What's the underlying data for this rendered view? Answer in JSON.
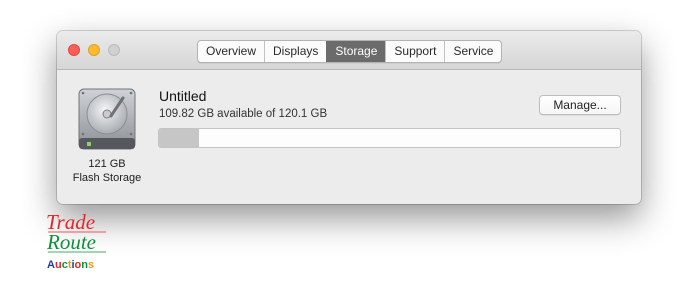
{
  "window": {
    "tabs": [
      {
        "label": "Overview",
        "active": false
      },
      {
        "label": "Displays",
        "active": false
      },
      {
        "label": "Storage",
        "active": true
      },
      {
        "label": "Support",
        "active": false
      },
      {
        "label": "Service",
        "active": false
      }
    ]
  },
  "drive": {
    "icon": "hard-drive-icon",
    "size": "121 GB",
    "type": "Flash Storage"
  },
  "volume": {
    "name": "Untitled",
    "available": "109.82 GB available of 120.1 GB",
    "used_fraction": 0.086
  },
  "manage_button": {
    "label": "Manage..."
  },
  "watermark": {
    "line1": "Trade",
    "line2": "Route",
    "line3": "Auctions"
  },
  "colors": {
    "close": "#fc5f57",
    "minimize": "#fdbc2e",
    "zoom_disabled": "#d0d0d0",
    "active_tab": "#6b6b6b",
    "bar_used": "#c6c6c6",
    "logo_red": "#e4262d",
    "logo_green": "#0e8f3a"
  }
}
